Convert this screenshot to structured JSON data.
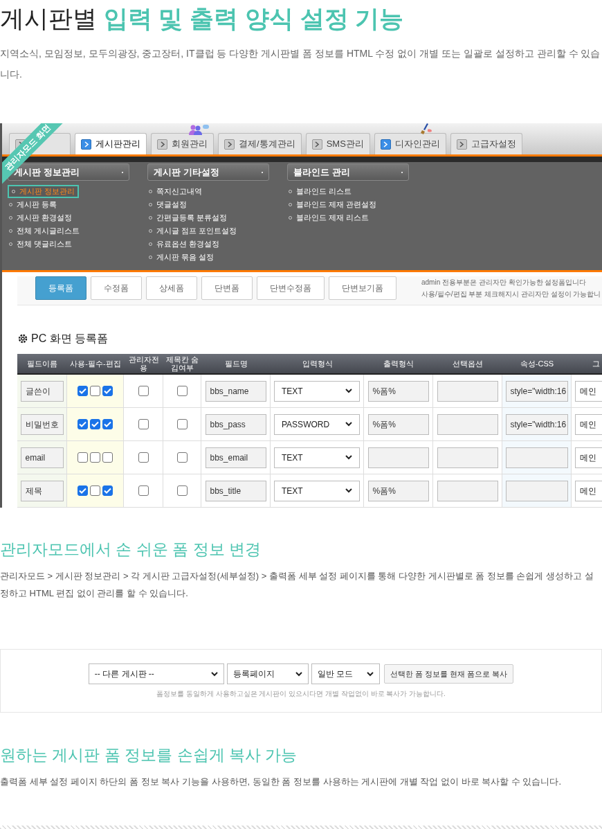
{
  "title": {
    "plain": "게시판별 ",
    "accent": "입력 및 출력 양식 설정 기능"
  },
  "description": "지역소식, 모임정보, 모두의광장, 중고장터, IT클럽 등 다양한 게시판별 폼 정보를 HTML 수정 없이 개별 또는 일괄로 설정하고 관리할 수 있습니다.",
  "admin_screen": {
    "ribbon": "관리자모드 화면",
    "tabs": [
      {
        "selected": false,
        "icon_active": false
      },
      {
        "label": "게시판관리",
        "selected": true,
        "icon_active": true
      },
      {
        "label": "회원관리",
        "selected": false,
        "icon_active": false,
        "kind": "people"
      },
      {
        "label": "결제/통계관리",
        "selected": false,
        "icon_active": false
      },
      {
        "label": "SMS관리",
        "selected": false,
        "icon_active": false
      },
      {
        "label": "디자인관리",
        "selected": false,
        "icon_active": true,
        "kind": "brush"
      },
      {
        "label": "고급자설정",
        "selected": false,
        "icon_active": false
      }
    ],
    "menus": [
      {
        "title": "게시판 정보관리",
        "items": [
          {
            "label": "게시판 정보관리",
            "selected": true
          },
          {
            "label": "게시판 등록",
            "selected": false
          },
          {
            "label": "게시판 환경설정",
            "selected": false
          },
          {
            "label": "전체 게시글리스트",
            "selected": false
          },
          {
            "label": "전체 댓글리스트",
            "selected": false
          }
        ]
      },
      {
        "title": "게시판 기타설정",
        "items": [
          {
            "label": "쪽지신고내역",
            "selected": false
          },
          {
            "label": "댓글설정",
            "selected": false
          },
          {
            "label": "간편글등록 분류설정",
            "selected": false
          },
          {
            "label": "게시글 점프 포인트설정",
            "selected": false
          },
          {
            "label": "유료옵션 환경설정",
            "selected": false
          },
          {
            "label": "게시판 묶음 설정",
            "selected": false
          }
        ]
      },
      {
        "title": "블라인드 관리",
        "items": [
          {
            "label": "블라인드 리스트",
            "selected": false
          },
          {
            "label": "블라인드 제재 관련설정",
            "selected": false
          },
          {
            "label": "블라인드 제재 리스트",
            "selected": false
          }
        ]
      }
    ],
    "form_buttons": [
      {
        "label": "등록폼",
        "selected": true
      },
      {
        "label": "수정폼",
        "selected": false
      },
      {
        "label": "상세폼",
        "selected": false
      },
      {
        "label": "단변폼",
        "selected": false
      },
      {
        "label": "단변수정폼",
        "selected": false
      },
      {
        "label": "단변보기폼",
        "selected": false
      }
    ],
    "notes": [
      "admin 전용부분은 관리자만 확인가능한 설정폼입니다",
      "사용/필수/편집 부분 체크해지시 관리자만 설정이 가능합니"
    ],
    "form_title": "PC 화면 등록폼",
    "table": {
      "columns": [
        "필드이름",
        "사용-필수-편집",
        "관리자전용",
        "제목칸 숨김여부",
        "필드명",
        "입력형식",
        "출력형식",
        "선택옵션",
        "속성-CSS",
        "그"
      ],
      "rows": [
        {
          "field_label": "글쓴이",
          "checks": [
            true,
            false,
            true
          ],
          "admin_only": false,
          "hide_title": false,
          "field_name": "bbs_name",
          "input_type": "TEXT",
          "output_format": "%폼%",
          "css": "style=\"width:16",
          "group": "메인"
        },
        {
          "field_label": "비밀번호",
          "checks": [
            true,
            true,
            true
          ],
          "admin_only": false,
          "hide_title": false,
          "field_name": "bbs_pass",
          "input_type": "PASSWORD",
          "output_format": "%폼%",
          "css": "style=\"width:16",
          "group": "메인"
        },
        {
          "field_label": "email",
          "checks": [
            false,
            false,
            false
          ],
          "admin_only": false,
          "hide_title": false,
          "field_name": "bbs_email",
          "input_type": "TEXT",
          "group": "메인"
        },
        {
          "field_label": "제목",
          "checks": [
            true,
            false,
            true
          ],
          "admin_only": false,
          "hide_title": false,
          "field_name": "bbs_title",
          "input_type": "TEXT",
          "output_format": "%폼%",
          "group": "메인"
        }
      ]
    }
  },
  "section2": {
    "heading": "관리자모드에서 손 쉬운 폼 정보 변경",
    "text": "관리자모드 > 게시판 정보관리 > 각 게시판 고급자설정(세부설정) > 출력폼 세부 설정 페이지를 통해 다양한 게시판별로 폼 정보를 손쉽게 생성하고 설정하고 HTML 편집 없이 관리를 할 수 있습니다."
  },
  "copy_panel": {
    "selects": [
      "-- 다른 게시판 --",
      "등록페이지",
      "일반 모드"
    ],
    "button": "선택한 폼 정보를 현재 폼으로 복사",
    "note": "폼정보를 동일하게 사용하고싶은 게시판이 있으시다면 개별 작업없이 바로 복사가 가능합니다."
  },
  "section3": {
    "heading": "원하는 게시판 폼 정보를 손쉽게 복사 가능",
    "text": "출력폼 세부 설정 페이지 하단의 폼 정보 복사 기능을 사용하면, 동일한 폼 정보를 사용하는 게시판에 개별 작업 없이 바로 복사할 수 있습니다."
  }
}
